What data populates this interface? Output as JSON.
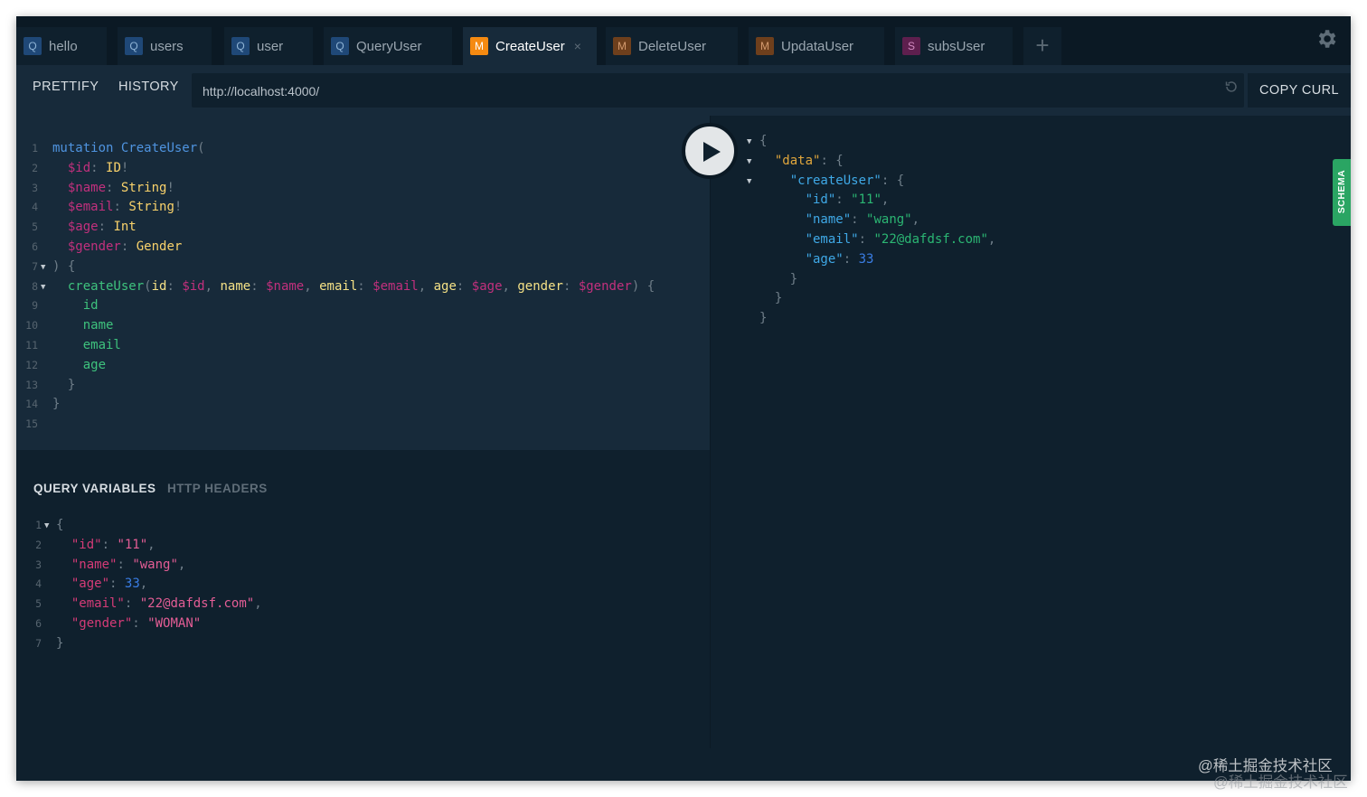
{
  "tabs": [
    {
      "badge": "Q",
      "label": "hello"
    },
    {
      "badge": "Q",
      "label": "users"
    },
    {
      "badge": "Q",
      "label": "user"
    },
    {
      "badge": "Q",
      "label": "QueryUser"
    },
    {
      "badge": "M",
      "label": "CreateUser",
      "active": true
    },
    {
      "badge": "M",
      "label": "DeleteUser"
    },
    {
      "badge": "M",
      "label": "UpdataUser"
    },
    {
      "badge": "S",
      "label": "subsUser"
    }
  ],
  "tab_close": "×",
  "add_tab": "+",
  "toolbar": {
    "prettify": "PRETTIFY",
    "history": "HISTORY",
    "url": "http://localhost:4000/",
    "copy_curl": "COPY CURL"
  },
  "query_lines": [
    "mutation CreateUser(",
    "  $id: ID!",
    "  $name: String!",
    "  $email: String!",
    "  $age: Int",
    "  $gender: Gender",
    ") {",
    "  createUser(id: $id, name: $name, email: $email, age: $age, gender: $gender) {",
    "    id",
    "    name",
    "    email",
    "    age",
    "  }",
    "}",
    ""
  ],
  "variables_tabs": {
    "query_variables": "QUERY VARIABLES",
    "http_headers": "HTTP HEADERS"
  },
  "variables_lines": [
    "{",
    "  \"id\": \"11\",",
    "  \"name\": \"wang\",",
    "  \"age\": 33,",
    "  \"email\": \"22@dafdsf.com\",",
    "  \"gender\": \"WOMAN\"",
    "}"
  ],
  "result_lines": [
    "{",
    "  \"data\": {",
    "    \"createUser\": {",
    "      \"id\": \"11\",",
    "      \"name\": \"wang\",",
    "      \"email\": \"22@dafdsf.com\",",
    "      \"age\": 33",
    "    }",
    "  }",
    "}"
  ],
  "schema_label": "SCHEMA",
  "watermark": "@稀土掘金技术社区",
  "icons": {
    "settings": "gear-icon",
    "run": "play-icon",
    "reload": "reload-icon"
  }
}
